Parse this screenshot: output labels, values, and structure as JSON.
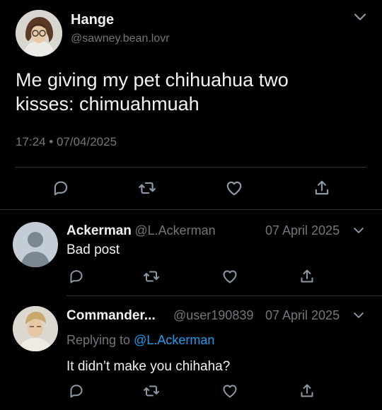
{
  "main_tweet": {
    "author_name": "Hange",
    "author_handle": "@sawney.bean.lovr",
    "text_line1": "Me giving my pet chihuahua two",
    "text_line2": "kisses: chimuahmuah",
    "timestamp": "17:24 • 07/04/2025",
    "actions": [
      "reply-icon",
      "retweet-icon",
      "like-icon",
      "share-icon"
    ]
  },
  "replies": [
    {
      "author_name": "Ackerman",
      "author_handle": "@L.Ackerman",
      "date": "07 April 2025",
      "text": "Bad post",
      "avatar": "default-avatar"
    },
    {
      "author_name": "Commander...",
      "author_handle": "@user190839",
      "date": "07 April 2025",
      "replying_prefix": "Replying to ",
      "replying_to": "@L.Ackerman",
      "text": "It didn’t make you chihaha?",
      "avatar": "character-avatar"
    }
  ],
  "colors": {
    "background": "#000000",
    "text": "#f1f1f1",
    "muted": "#71767b",
    "link": "#1d9bf0",
    "divider": "#2f3336"
  }
}
